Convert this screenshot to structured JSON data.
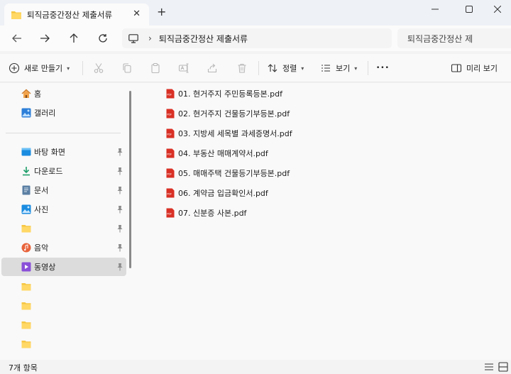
{
  "tab": {
    "title": "퇴직금중간정산 제출서류",
    "close": "✕",
    "add": "+"
  },
  "window": {
    "minimize": "—",
    "maximize": "☐",
    "close": "✕"
  },
  "address": {
    "separator": "›",
    "path": "퇴직금중간정산 제출서류"
  },
  "search": {
    "placeholder": "퇴직금중간정산 제"
  },
  "commands": {
    "new_label": "새로 만들기",
    "sort_label": "정렬",
    "view_label": "보기",
    "more": "•••",
    "preview_label": "미리 보기"
  },
  "sidebar": {
    "top_items": [
      {
        "label": "홈"
      },
      {
        "label": "갤러리"
      }
    ],
    "pinned": [
      {
        "label": "바탕 화면"
      },
      {
        "label": "다운로드"
      },
      {
        "label": "문서"
      },
      {
        "label": "사진"
      },
      {
        "label": ""
      },
      {
        "label": "음악"
      },
      {
        "label": "동영상"
      }
    ]
  },
  "files": [
    {
      "name": "01. 현거주지 주민등록등본.pdf"
    },
    {
      "name": "02. 현거주지 건물등기부등본.pdf"
    },
    {
      "name": "03. 지방세 세목별 과세증명서.pdf"
    },
    {
      "name": "04. 부동산 매매계약서.pdf"
    },
    {
      "name": "05. 매매주택 건물등기부등본.pdf"
    },
    {
      "name": "06. 계약금 입금확인서.pdf"
    },
    {
      "name": "07. 신분증 사본.pdf"
    }
  ],
  "status": {
    "item_count": "7개 항목"
  },
  "colors": {
    "folder": "#f6c643",
    "pdf": "#d93025",
    "accent": "#0067c0"
  }
}
